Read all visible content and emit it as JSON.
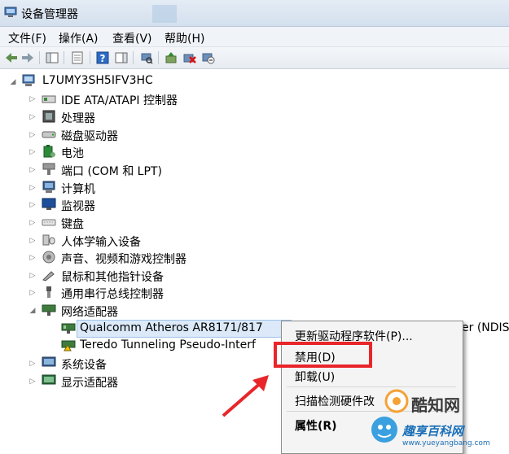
{
  "window": {
    "title": "设备管理器"
  },
  "menu": [
    "文件(F)",
    "操作(A)",
    "查看(V)",
    "帮助(H)"
  ],
  "tree": {
    "root": "L7UMY3SH5IFV3HC",
    "categories": [
      "IDE ATA/ATAPI 控制器",
      "处理器",
      "磁盘驱动器",
      "电池",
      "端口 (COM 和 LPT)",
      "计算机",
      "监视器",
      "键盘",
      "人体学输入设备",
      "声音、视频和游戏控制器",
      "鼠标和其他指针设备",
      "通用串行总线控制器",
      "网络适配器"
    ],
    "network_children": [
      "Qualcomm Atheros AR8171/817",
      "Teredo Tunneling Pseudo-Interf"
    ],
    "network_child_tail": "er (NDIS",
    "categories_after": [
      "系统设备",
      "显示适配器"
    ]
  },
  "context_menu": {
    "update": "更新驱动程序软件(P)...",
    "disable": "禁用(D)",
    "uninstall": "卸载(U)",
    "scan": "扫描检测硬件改",
    "properties": "属性(R)"
  },
  "watermark": {
    "brand": "酷知网",
    "sub": "趣享百科网",
    "url": "www.yueyangbang.com"
  },
  "colors": {
    "highlight": "#e8262a",
    "selection": "#dbe9f9"
  }
}
